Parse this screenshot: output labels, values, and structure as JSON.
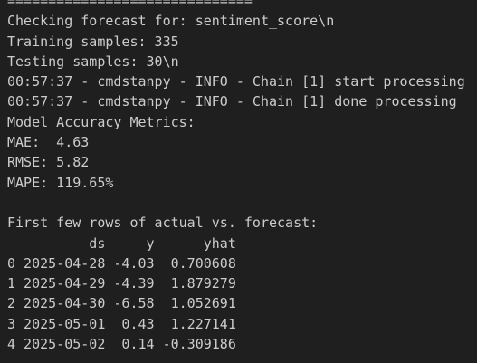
{
  "terminal": {
    "lines": [
      "==============================",
      "Checking forecast for: sentiment_score\\n",
      "Training samples: 335",
      "Testing samples: 30\\n",
      "00:57:37 - cmdstanpy - INFO - Chain [1] start processing",
      "00:57:37 - cmdstanpy - INFO - Chain [1] done processing",
      "Model Accuracy Metrics:",
      "MAE:  4.63",
      "RMSE: 5.82",
      "MAPE: 119.65%",
      "",
      "First few rows of actual vs. forecast:",
      "          ds     y      yhat",
      "0 2025-04-28 -4.03  0.700608",
      "1 2025-04-29 -4.39  1.879279",
      "2 2025-04-30 -6.58  1.052691",
      "3 2025-05-01  0.43  1.227141",
      "4 2025-05-02  0.14 -0.309186"
    ]
  },
  "colors": {
    "background": "#1f1f1f",
    "text": "#cccccc"
  }
}
